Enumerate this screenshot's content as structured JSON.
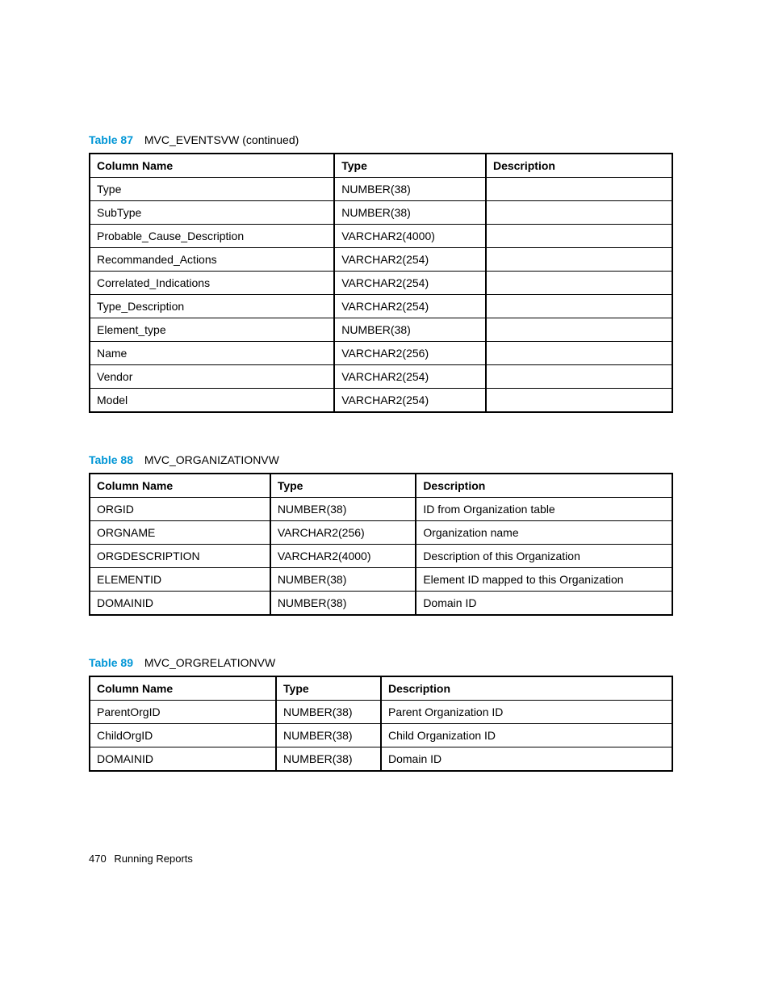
{
  "tables": {
    "t87": {
      "label": "Table 87",
      "title": "MVC_EVENTSVW (continued)",
      "headers": [
        "Column Name",
        "Type",
        "Description"
      ],
      "rows": [
        {
          "c0": "Type",
          "c1": "NUMBER(38)",
          "c2": ""
        },
        {
          "c0": "SubType",
          "c1": "NUMBER(38)",
          "c2": ""
        },
        {
          "c0": "Probable_Cause_Description",
          "c1": "VARCHAR2(4000)",
          "c2": ""
        },
        {
          "c0": "Recommanded_Actions",
          "c1": "VARCHAR2(254)",
          "c2": ""
        },
        {
          "c0": "Correlated_Indications",
          "c1": "VARCHAR2(254)",
          "c2": ""
        },
        {
          "c0": "Type_Description",
          "c1": "VARCHAR2(254)",
          "c2": ""
        },
        {
          "c0": "Element_type",
          "c1": "NUMBER(38)",
          "c2": ""
        },
        {
          "c0": "Name",
          "c1": "VARCHAR2(256)",
          "c2": ""
        },
        {
          "c0": "Vendor",
          "c1": "VARCHAR2(254)",
          "c2": ""
        },
        {
          "c0": "Model",
          "c1": "VARCHAR2(254)",
          "c2": ""
        }
      ]
    },
    "t88": {
      "label": "Table 88",
      "title": "MVC_ORGANIZATIONVW",
      "headers": [
        "Column Name",
        "Type",
        "Description"
      ],
      "rows": [
        {
          "c0": "ORGID",
          "c1": "NUMBER(38)",
          "c2": "ID from Organization table"
        },
        {
          "c0": "ORGNAME",
          "c1": "VARCHAR2(256)",
          "c2": "Organization name"
        },
        {
          "c0": "ORGDESCRIPTION",
          "c1": "VARCHAR2(4000)",
          "c2": "Description of this Organization"
        },
        {
          "c0": "ELEMENTID",
          "c1": "NUMBER(38)",
          "c2": "Element ID mapped to this Organization"
        },
        {
          "c0": "DOMAINID",
          "c1": "NUMBER(38)",
          "c2": "Domain ID"
        }
      ]
    },
    "t89": {
      "label": "Table 89",
      "title": "MVC_ORGRELATIONVW",
      "headers": [
        "Column Name",
        "Type",
        "Description"
      ],
      "rows": [
        {
          "c0": "ParentOrgID",
          "c1": "NUMBER(38)",
          "c2": "Parent Organization ID"
        },
        {
          "c0": "ChildOrgID",
          "c1": "NUMBER(38)",
          "c2": "Child Organization ID"
        },
        {
          "c0": "DOMAINID",
          "c1": "NUMBER(38)",
          "c2": "Domain ID"
        }
      ]
    }
  },
  "footer": {
    "page": "470",
    "section": "Running Reports"
  }
}
